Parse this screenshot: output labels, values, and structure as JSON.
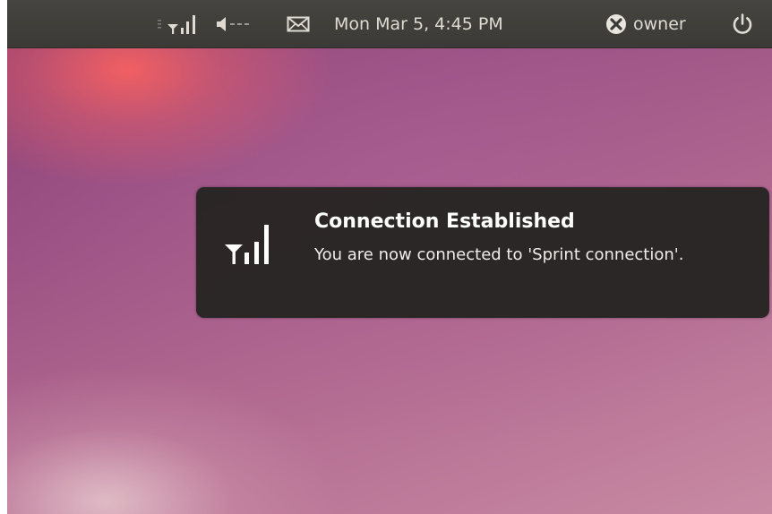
{
  "panel": {
    "clock": "Mon Mar  5,  4:45 PM",
    "user": "owner",
    "icons": {
      "network": "signal-strength-icon",
      "volume": "speaker-muted-icon",
      "mail": "envelope-icon",
      "user_status": "status-busy-icon",
      "power": "power-icon"
    }
  },
  "notification": {
    "title": "Connection Established",
    "body": "You are now connected to 'Sprint connection'.",
    "icon": "signal-strength-icon"
  },
  "colors": {
    "panel_bg": "#3c3b37",
    "panel_text": "#dfdbd2",
    "notification_bg": "#262422",
    "wallpaper_accent": "#f25f5f",
    "wallpaper_base": "#9a5083"
  }
}
